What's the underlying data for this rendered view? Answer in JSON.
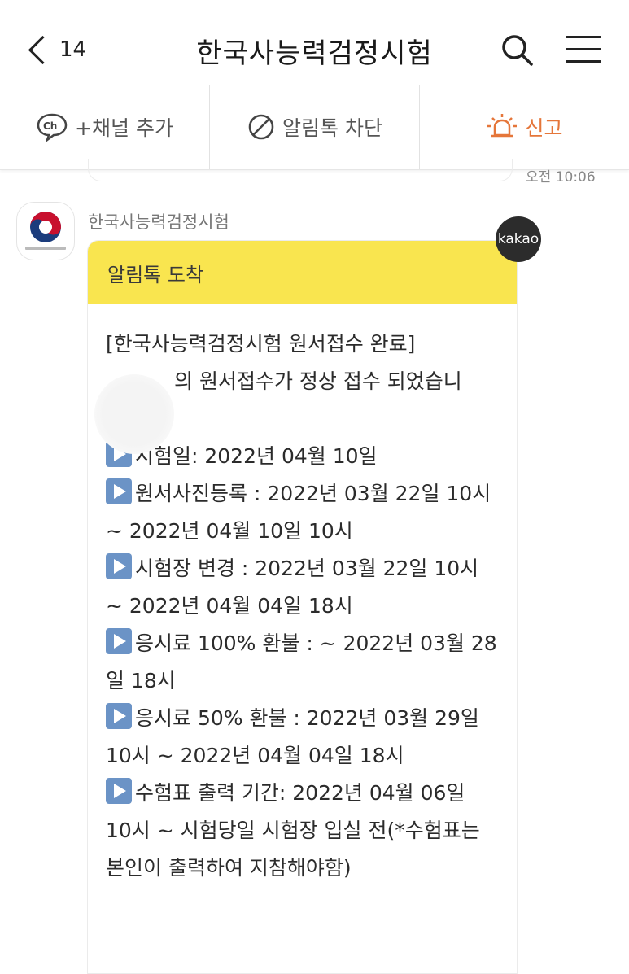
{
  "header": {
    "back_count": "14",
    "title": "한국사능력검정시험",
    "search_icon": "search-icon",
    "menu_icon": "menu-icon"
  },
  "actions": {
    "add_channel": "+채널 추가",
    "block": "알림톡 차단",
    "report": "신고"
  },
  "chat": {
    "prev_time": "오전 10:06",
    "sender": "한국사능력검정시험",
    "kakao_badge": "kakao",
    "card_header": "알림톡 도착",
    "message_title": "[한국사능력검정시험 원서접수 완료]",
    "intro": "의 원서접수가 정상 접수 되었습니",
    "lines": [
      "시험일: 2022년 04월 10일",
      "원서사진등록 : 2022년 03월 22일 10시 ~ 2022년 04월 10일 10시",
      "시험장 변경 : 2022년 03월 22일 10시 ~ 2022년 04월 04일 18시",
      "응시료 100% 환불 : ~ 2022년 03월 28일 18시",
      "응시료 50% 환불 : 2022년 03월 29일 10시 ~ 2022년 04월 04일 18시",
      "수험표 출력 기간: 2022년 04월 06일 10시 ~ 시험당일 시험장 입실 전(*수험표는 본인이 출력하여 지참해야함)"
    ]
  },
  "colors": {
    "kakao_yellow": "#f9e54f",
    "report_orange": "#e5763a",
    "play_blue": "#6b93c6"
  }
}
